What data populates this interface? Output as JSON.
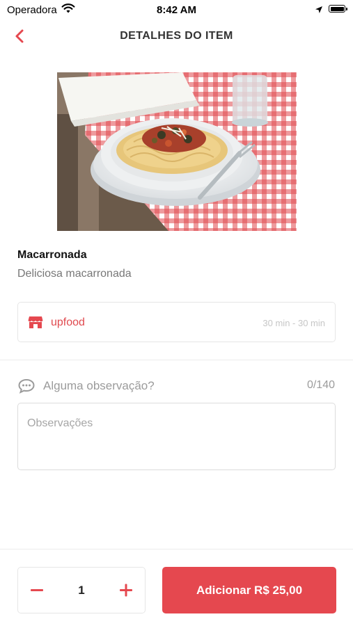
{
  "status_bar": {
    "carrier": "Operadora",
    "time": "8:42 AM"
  },
  "header": {
    "title": "DETALHES DO ITEM"
  },
  "item": {
    "name": "Macarronada",
    "description": "Deliciosa macarronada"
  },
  "store": {
    "name": "upfood",
    "delivery_time": "30 min - 30 min"
  },
  "observations": {
    "label": "Alguma observação?",
    "counter": "0/140",
    "placeholder": "Observações",
    "value": ""
  },
  "footer": {
    "quantity": "1",
    "add_button_label": "Adicionar R$ 25,00"
  },
  "colors": {
    "accent": "#e5484f",
    "text_muted": "#9b9b9b"
  },
  "icons": {
    "back": "chevron-left-icon",
    "store": "storefront-icon",
    "observations": "chat-bubble-icon",
    "minus": "minus-icon",
    "plus": "plus-icon"
  }
}
